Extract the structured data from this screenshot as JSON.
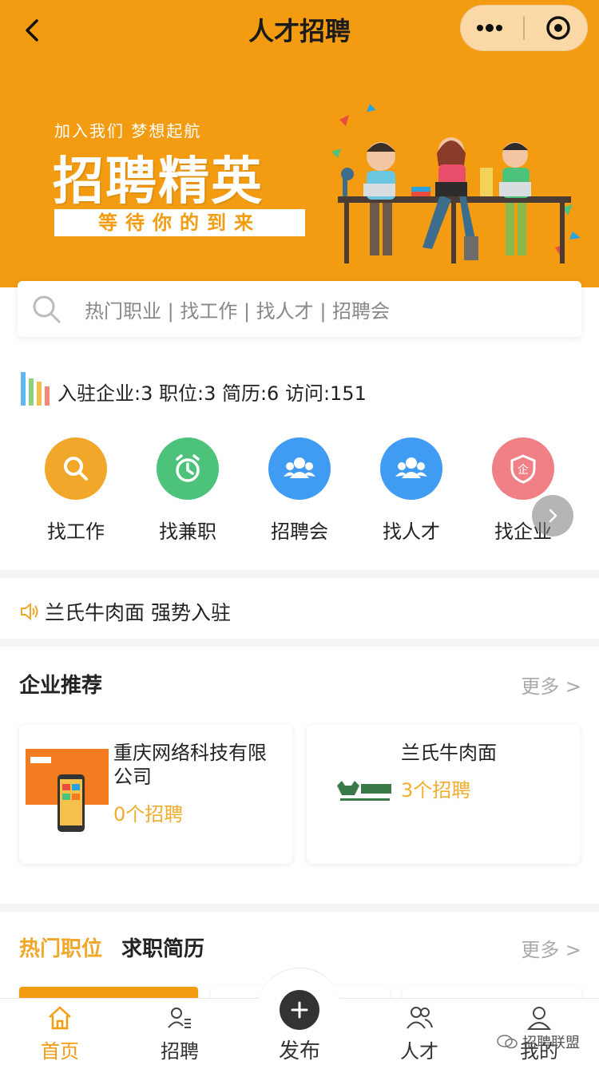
{
  "header": {
    "title": "人才招聘",
    "back_icon": "chevron-left-icon",
    "more_icon": "more-dots-icon",
    "close_icon": "target-icon"
  },
  "banner": {
    "small": "加入我们 梦想起航",
    "big": "招聘精英",
    "strip": "等待你的到来"
  },
  "search": {
    "placeholder": "热门职业 | 找工作 | 找人才 | 招聘会"
  },
  "stats": {
    "text": "入驻企业:3 职位:3 简历:6 访问:151"
  },
  "quick": [
    {
      "label": "找工作",
      "color": "#f0a72a",
      "icon": "search-icon"
    },
    {
      "label": "找兼职",
      "color": "#4cc27a",
      "icon": "alarm-clock-icon"
    },
    {
      "label": "招聘会",
      "color": "#3f9cf2",
      "icon": "people-icon"
    },
    {
      "label": "找人才",
      "color": "#3f9cf2",
      "icon": "people-icon"
    },
    {
      "label": "找企业",
      "color": "#f07f86",
      "icon": "shield-icon"
    }
  ],
  "notice": {
    "text": "兰氏牛肉面 强势入驻"
  },
  "companies": {
    "title": "企业推荐",
    "more": "更多 >",
    "items": [
      {
        "name": "重庆网络科技有限公司",
        "jobs": "0个招聘"
      },
      {
        "name": "兰氏牛肉面",
        "jobs": "3个招聘"
      }
    ]
  },
  "jobs": {
    "tab_hot": "热门职位",
    "tab_resume": "求职简历",
    "more": "更多 >"
  },
  "tabbar": {
    "home": "首页",
    "recruit": "招聘",
    "publish": "发布",
    "talent": "人才",
    "mine": "我的"
  },
  "watermark": "招聘联盟",
  "colors": {
    "accent": "#f39c12",
    "price": "#f0ad2e"
  }
}
